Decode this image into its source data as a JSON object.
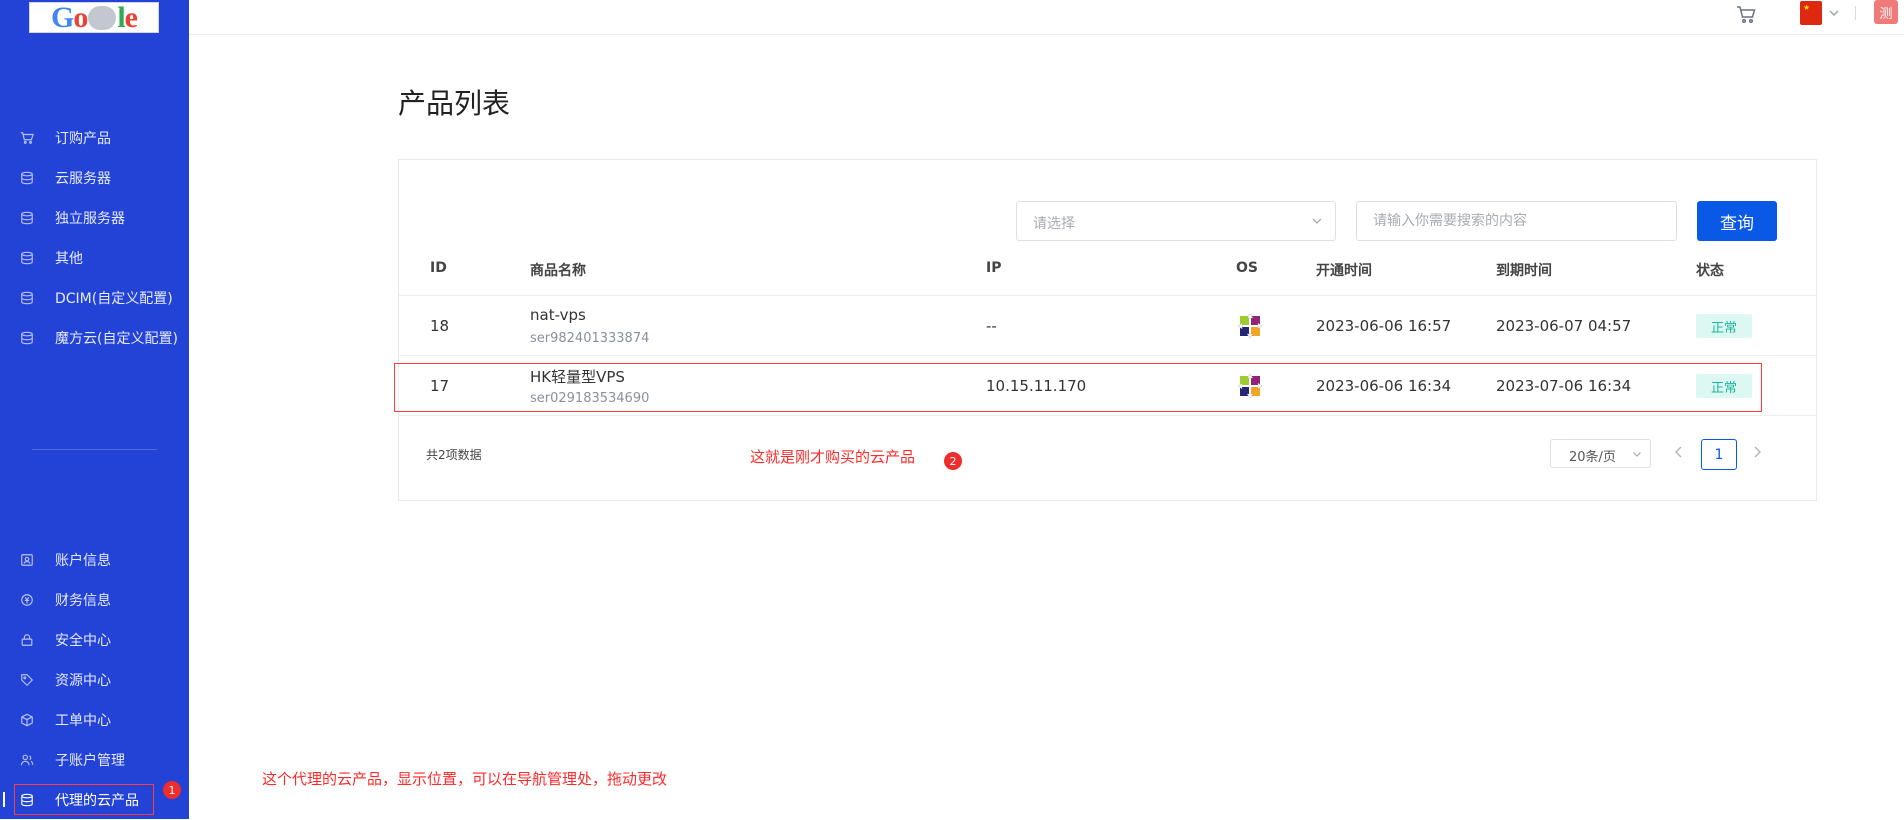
{
  "logo": {
    "alt_text": "Google"
  },
  "sidebar": {
    "items_top": [
      {
        "label": "订购产品",
        "icon": "cart-icon"
      },
      {
        "label": "云服务器",
        "icon": "database-icon"
      },
      {
        "label": "独立服务器",
        "icon": "database-icon"
      },
      {
        "label": "其他",
        "icon": "database-icon"
      },
      {
        "label": "DCIM(自定义配置)",
        "icon": "database-icon"
      },
      {
        "label": "魔方云(自定义配置)",
        "icon": "database-icon"
      }
    ],
    "items_bottom": [
      {
        "label": "账户信息",
        "icon": "user-card-icon"
      },
      {
        "label": "财务信息",
        "icon": "coin-icon"
      },
      {
        "label": "安全中心",
        "icon": "lock-icon"
      },
      {
        "label": "资源中心",
        "icon": "tag-icon"
      },
      {
        "label": "工单中心",
        "icon": "box-icon"
      },
      {
        "label": "子账户管理",
        "icon": "users-icon"
      },
      {
        "label": "代理的云产品",
        "icon": "database-icon",
        "active": true
      }
    ],
    "badge_1": "1"
  },
  "topbar": {
    "avatar_text": "测",
    "language_flag": "china-flag"
  },
  "page": {
    "title": "产品列表",
    "filter_placeholder": "请选择",
    "search_placeholder": "请输入你需要搜索的内容",
    "query_button": "查询"
  },
  "table": {
    "headers": [
      "ID",
      "商品名称",
      "IP",
      "OS",
      "开通时间",
      "到期时间",
      "状态"
    ],
    "rows": [
      {
        "id": "18",
        "name": "nat-vps",
        "serial": "ser982401333874",
        "ip": "--",
        "open_time": "2023-06-06 16:57",
        "expire_time": "2023-06-07 04:57",
        "status": "正常"
      },
      {
        "id": "17",
        "name": "HK轻量型VPS",
        "serial": "ser029183534690",
        "ip": "10.15.11.170",
        "open_time": "2023-06-06 16:34",
        "expire_time": "2023-07-06 16:34",
        "status": "正常"
      }
    ]
  },
  "pagination": {
    "total_text": "共2项数据",
    "page_size": "20条/页",
    "current_page": "1"
  },
  "annotations": {
    "note_2": "这就是刚才购买的云产品",
    "badge_2": "2",
    "note_1": "这个代理的云产品，显示位置，可以在导航管理处，拖动更改"
  },
  "colors": {
    "sidebar_bg": "#2343d7",
    "primary": "#0a58e6",
    "status_bg": "#ddf7f3",
    "status_text": "#19b89a",
    "annotation": "#ff2a2a"
  }
}
